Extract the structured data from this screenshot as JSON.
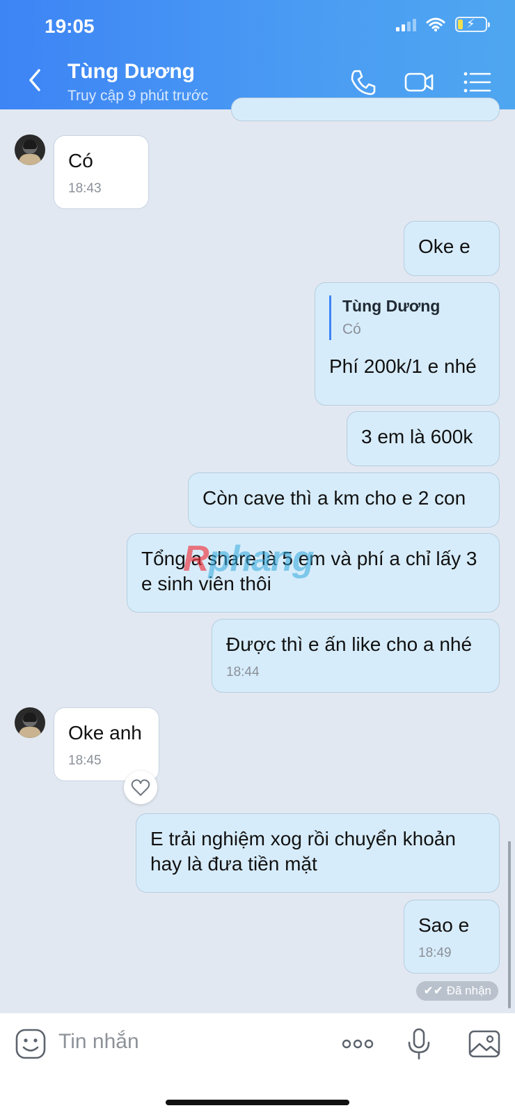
{
  "status_bar": {
    "time": "19:05"
  },
  "header": {
    "contact_name": "Tùng Dương",
    "contact_status": "Truy cập 9 phút trước"
  },
  "messages": [
    {
      "dir": "in",
      "text": "Có",
      "time": "18:43"
    },
    {
      "dir": "out",
      "text": "Oke e"
    },
    {
      "dir": "out",
      "quote_name": "Tùng Dương",
      "quote_text": "Có",
      "text": "Phí 200k/1 e nhé"
    },
    {
      "dir": "out",
      "text": "3 em là 600k"
    },
    {
      "dir": "out",
      "text": "Còn cave thì a km cho e 2 con"
    },
    {
      "dir": "out",
      "text": "Tổng a share là 5 em và phí a chỉ lấy 3 e sinh viên thôi"
    },
    {
      "dir": "out",
      "text": "Được thì e ấn like cho a nhé",
      "time": "18:44"
    },
    {
      "dir": "in",
      "text": "Oke anh",
      "time": "18:45"
    },
    {
      "dir": "out",
      "text": "E trải nghiệm xog rồi chuyển khoản hay là đưa tiền mặt"
    },
    {
      "dir": "out",
      "text": "Sao e",
      "time": "18:49"
    }
  ],
  "delivery_status": "Đã nhận",
  "watermark": {
    "part1": "R",
    "part2": "phang"
  },
  "input": {
    "placeholder": "Tin nhắn"
  },
  "icons": {
    "back": "chevron-left-icon",
    "call": "phone-icon",
    "video": "video-camera-icon",
    "menu": "list-menu-icon",
    "sticker": "emoji-icon",
    "more": "more-dots-icon",
    "mic": "microphone-icon",
    "image": "image-icon",
    "like": "heart-icon"
  }
}
